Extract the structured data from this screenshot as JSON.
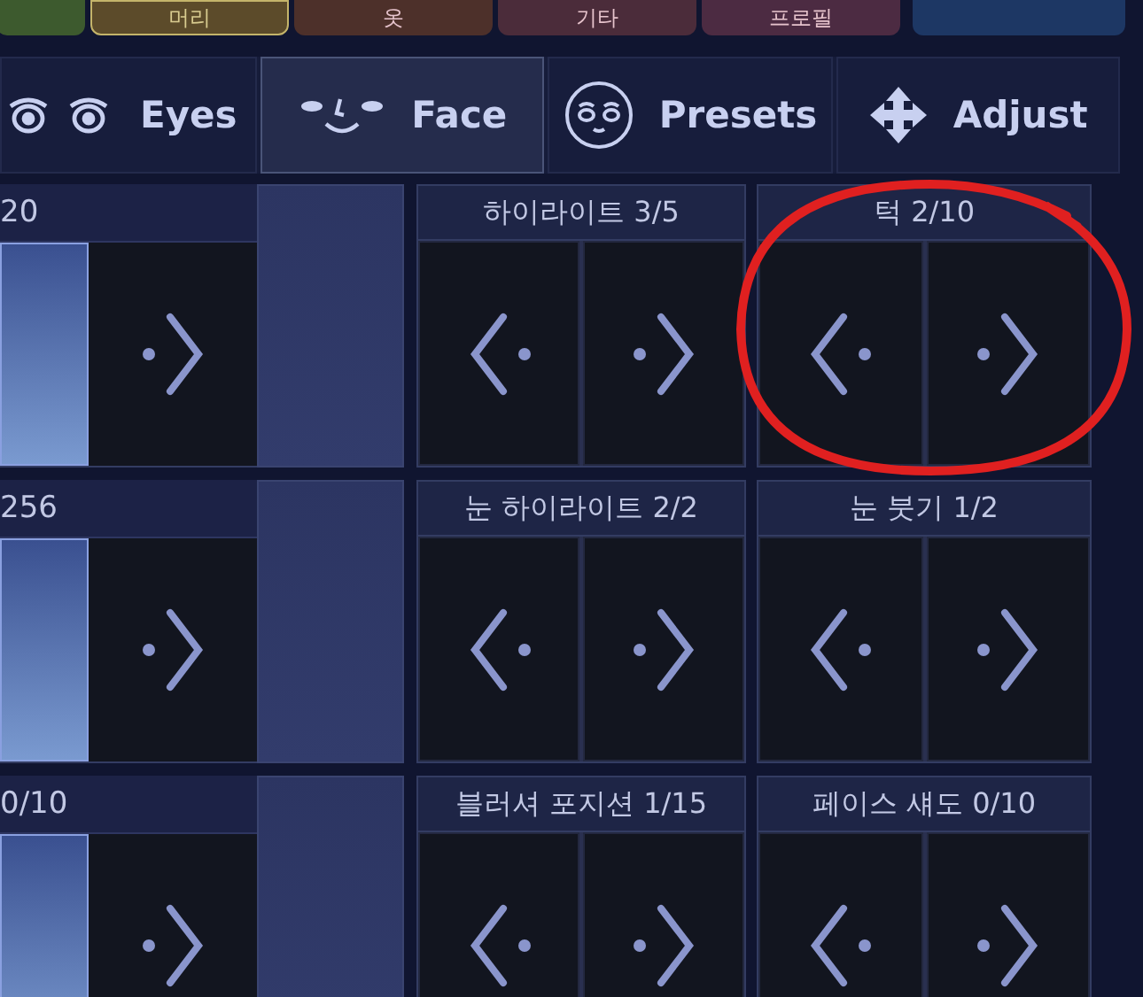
{
  "category_tabs": [
    {
      "color": "#3d5a2e",
      "selected": false
    },
    {
      "label": "머리",
      "color": "#5c4b2a",
      "selected": true
    },
    {
      "label": "옷",
      "color": "#4d302a",
      "selected": false
    },
    {
      "label": "기타",
      "color": "#4b2c3a",
      "selected": false
    },
    {
      "label": "프로필",
      "color": "#4c2b42",
      "selected": false
    },
    {
      "color": "#1d3764",
      "selected": false
    }
  ],
  "mode_tabs": [
    {
      "label": "Eyes",
      "selected": false
    },
    {
      "label": "Face",
      "selected": true
    },
    {
      "label": "Presets",
      "selected": false
    },
    {
      "label": "Adjust",
      "selected": false
    }
  ],
  "left_column": [
    {
      "label": "20",
      "highlighted": true
    },
    {
      "label": "256",
      "highlighted": true
    },
    {
      "label": "0/10",
      "highlighted": true
    }
  ],
  "cards": [
    {
      "label": "하이라이트 3/5"
    },
    {
      "label": "턱 2/10"
    },
    {
      "label": "눈 하이라이트 2/2"
    },
    {
      "label": "눈 붓기 1/2"
    },
    {
      "label": "블러셔 포지션 1/15"
    },
    {
      "label": "페이스 섀도 0/10"
    }
  ]
}
